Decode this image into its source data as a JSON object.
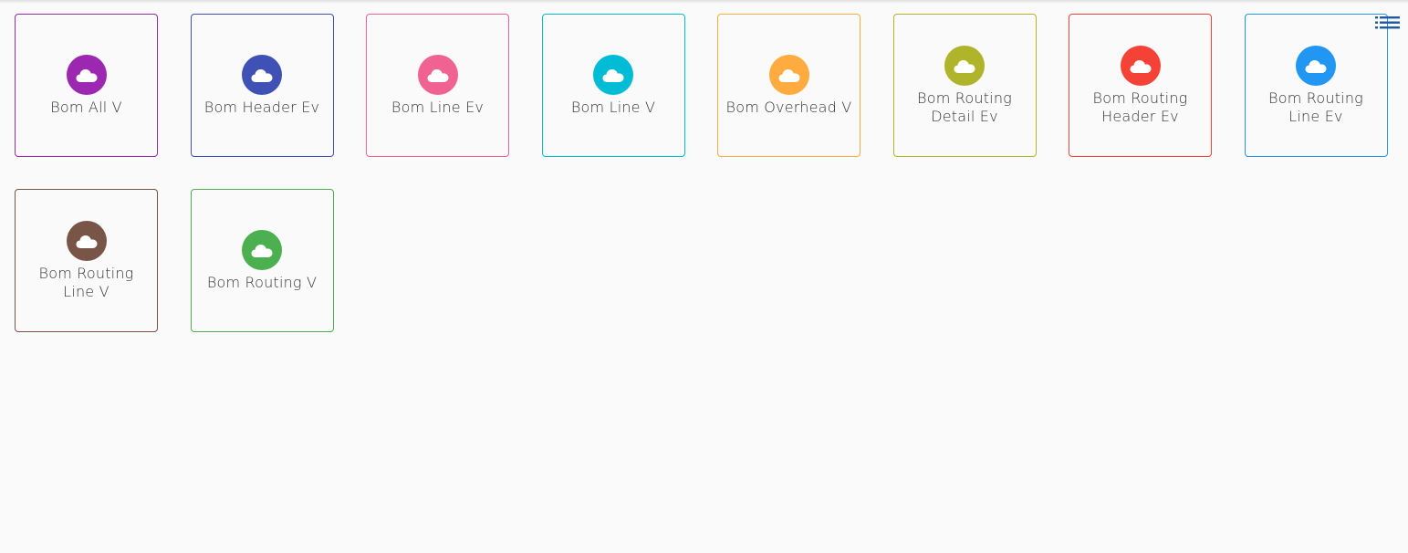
{
  "toolbar": {
    "menu_icon": "list-icon",
    "menu_color": "#1e5aa0"
  },
  "tiles": [
    {
      "label": "Bom All V",
      "color": "#9c27b0",
      "icon": "cloud-icon"
    },
    {
      "label": "Bom Header Ev",
      "color": "#3f51b5",
      "icon": "cloud-icon"
    },
    {
      "label": "Bom Line Ev",
      "color": "#f06292",
      "icon": "cloud-icon"
    },
    {
      "label": "Bom Line V",
      "color": "#00bcd4",
      "icon": "cloud-icon"
    },
    {
      "label": "Bom Overhead V",
      "color": "#ffab40",
      "icon": "cloud-icon"
    },
    {
      "label": "Bom Routing Detail Ev",
      "color": "#afb42b",
      "icon": "cloud-icon"
    },
    {
      "label": "Bom Routing Header Ev",
      "color": "#f44336",
      "icon": "cloud-icon"
    },
    {
      "label": "Bom Routing Line Ev",
      "color": "#2196f3",
      "icon": "cloud-icon"
    },
    {
      "label": "Bom Routing Line V",
      "color": "#795548",
      "icon": "cloud-icon"
    },
    {
      "label": "Bom Routing V",
      "color": "#4caf50",
      "icon": "cloud-icon"
    }
  ]
}
